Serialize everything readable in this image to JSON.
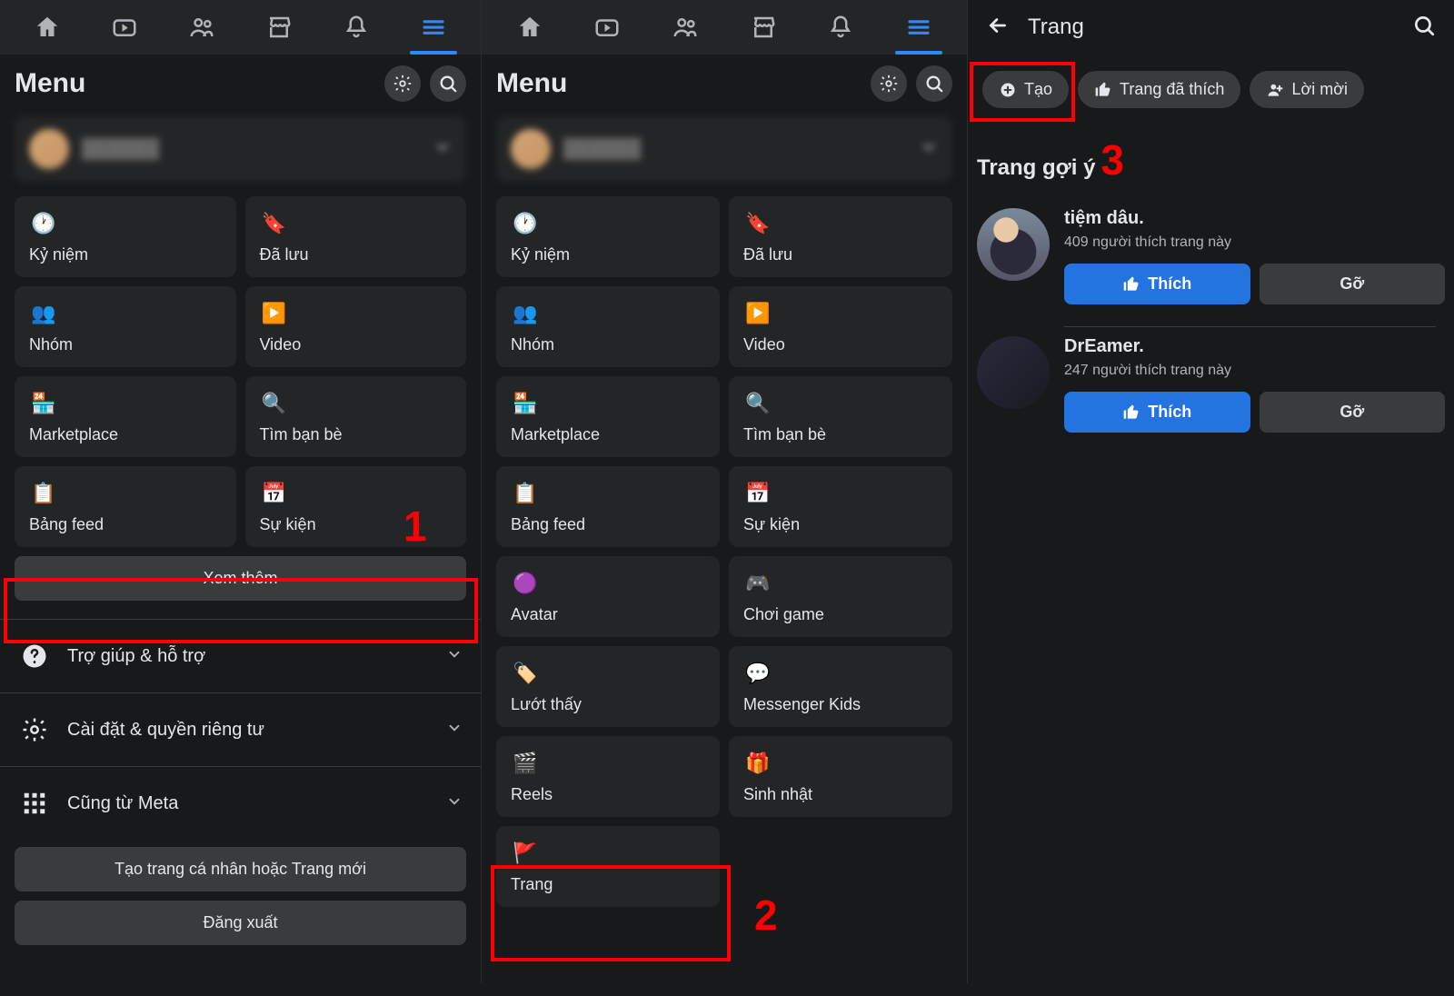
{
  "panel1": {
    "menu_title": "Menu",
    "tiles": [
      {
        "label": "Kỷ niệm",
        "icon": "🕐",
        "name": "tile-memories"
      },
      {
        "label": "Đã lưu",
        "icon": "🔖",
        "name": "tile-saved"
      },
      {
        "label": "Nhóm",
        "icon": "👥",
        "name": "tile-groups"
      },
      {
        "label": "Video",
        "icon": "▶️",
        "name": "tile-video"
      },
      {
        "label": "Marketplace",
        "icon": "🏪",
        "name": "tile-marketplace"
      },
      {
        "label": "Tìm bạn bè",
        "icon": "🔍",
        "name": "tile-find-friends"
      },
      {
        "label": "Bảng feed",
        "icon": "📋",
        "name": "tile-feeds"
      },
      {
        "label": "Sự kiện",
        "icon": "📅",
        "name": "tile-events"
      }
    ],
    "see_more": "Xem thêm",
    "footer": [
      {
        "label": "Trợ giúp & hỗ trợ",
        "name": "footer-help",
        "icon": "help"
      },
      {
        "label": "Cài đặt & quyền riêng tư",
        "name": "footer-settings",
        "icon": "gear"
      },
      {
        "label": "Cũng từ Meta",
        "name": "footer-meta",
        "icon": "grid"
      }
    ],
    "create_profile": "Tạo trang cá nhân hoặc Trang mới",
    "logout": "Đăng xuất"
  },
  "panel2": {
    "menu_title": "Menu",
    "tiles": [
      {
        "label": "Kỷ niệm",
        "icon": "🕐",
        "name": "tile-memories"
      },
      {
        "label": "Đã lưu",
        "icon": "🔖",
        "name": "tile-saved"
      },
      {
        "label": "Nhóm",
        "icon": "👥",
        "name": "tile-groups"
      },
      {
        "label": "Video",
        "icon": "▶️",
        "name": "tile-video"
      },
      {
        "label": "Marketplace",
        "icon": "🏪",
        "name": "tile-marketplace"
      },
      {
        "label": "Tìm bạn bè",
        "icon": "🔍",
        "name": "tile-find-friends"
      },
      {
        "label": "Bảng feed",
        "icon": "📋",
        "name": "tile-feeds"
      },
      {
        "label": "Sự kiện",
        "icon": "📅",
        "name": "tile-events"
      },
      {
        "label": "Avatar",
        "icon": "🟣",
        "name": "tile-avatar"
      },
      {
        "label": "Chơi game",
        "icon": "🎮",
        "name": "tile-gaming"
      },
      {
        "label": "Lướt thấy",
        "icon": "🏷️",
        "name": "tile-reels-feed"
      },
      {
        "label": "Messenger Kids",
        "icon": "💬",
        "name": "tile-messenger-kids"
      },
      {
        "label": "Reels",
        "icon": "🎬",
        "name": "tile-reels"
      },
      {
        "label": "Sinh nhật",
        "icon": "🎁",
        "name": "tile-birthdays"
      },
      {
        "label": "Trang",
        "icon": "🚩",
        "name": "tile-pages"
      }
    ]
  },
  "panel3": {
    "header_title": "Trang",
    "pills": {
      "create": "Tạo",
      "liked": "Trang đã thích",
      "invites": "Lời mời"
    },
    "suggested_heading": "Trang gợi ý",
    "suggestions": [
      {
        "name": "tiệm dâu.",
        "meta": "409 người thích trang này",
        "bold_only_first": "tiệm dâu"
      },
      {
        "name": "DrEamer.",
        "meta": "247 người thích trang này",
        "bold_only_first": "DrEamer"
      }
    ],
    "like_label": "Thích",
    "dismiss_label": "Gỡ"
  },
  "annotations": {
    "step1": "1",
    "step2": "2",
    "step3": "3"
  }
}
